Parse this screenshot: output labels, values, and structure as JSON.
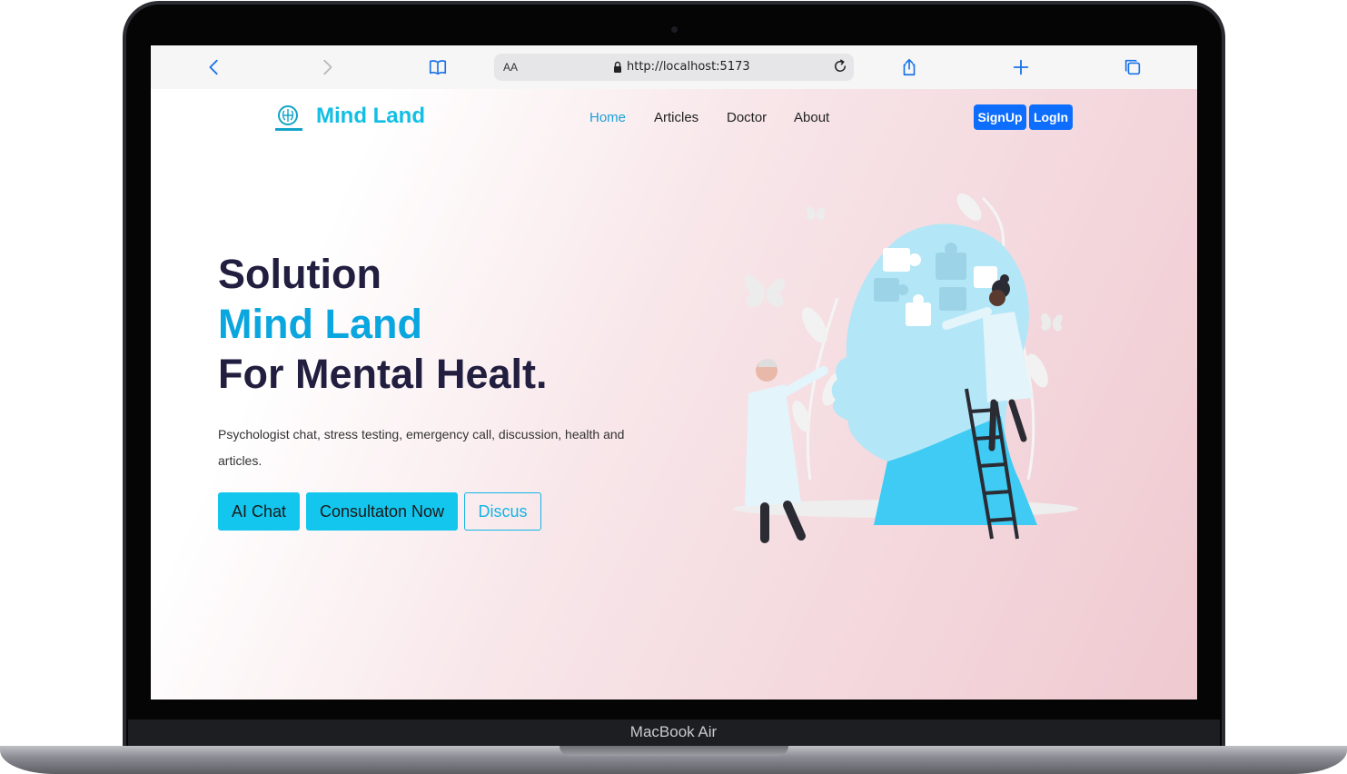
{
  "device": {
    "label": "MacBook Air"
  },
  "browser": {
    "text_size_label": "AA",
    "url": "http://localhost:5173"
  },
  "site": {
    "logo_text": "Mind Land",
    "nav": [
      {
        "label": "Home",
        "active": true
      },
      {
        "label": "Articles",
        "active": false
      },
      {
        "label": "Doctor",
        "active": false
      },
      {
        "label": "About",
        "active": false
      }
    ],
    "signup_label": "SignUp",
    "login_label": "LogIn"
  },
  "hero": {
    "line1": "Solution",
    "line2": "Mind Land",
    "line3": "For Mental Healt.",
    "description": "Psychologist chat, stress testing, emergency call, discussion, health and articles.",
    "buttons": {
      "ai_chat": "AI Chat",
      "consultation": "Consultaton Now",
      "discuss": "Discus"
    }
  },
  "colors": {
    "brand": "#12bfe4",
    "accent_text": "#0aa6df",
    "heading": "#221e3f",
    "auth_button": "#0d6efd",
    "cta": "#13c6ee"
  }
}
